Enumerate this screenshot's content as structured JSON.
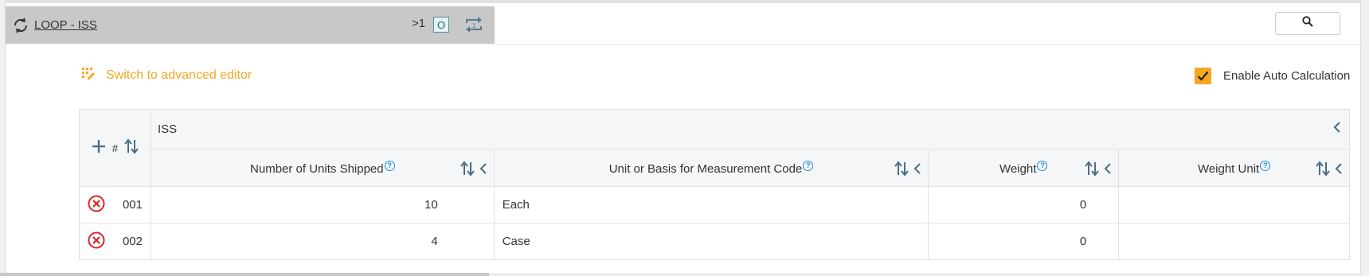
{
  "loop": {
    "title": "LOOP - ISS",
    "repeat_label": ">1",
    "badge": "O"
  },
  "toolbar": {
    "advanced_editor_label": "Switch to advanced editor",
    "auto_calc_label": "Enable Auto Calculation",
    "auto_calc_checked": true
  },
  "grid": {
    "hash_label": "#",
    "group_label": "ISS",
    "columns": [
      {
        "label": "Number of Units Shipped",
        "help": "?"
      },
      {
        "label": "Unit or Basis for Measurement Code",
        "help": "?"
      },
      {
        "label": "Weight",
        "help": "?"
      },
      {
        "label": "Weight Unit",
        "help": "?"
      }
    ],
    "rows": [
      {
        "num": "001",
        "units": "10",
        "basis": "Each",
        "weight": "0",
        "weight_unit": ""
      },
      {
        "num": "002",
        "units": "4",
        "basis": "Case",
        "weight": "0",
        "weight_unit": ""
      }
    ]
  },
  "colors": {
    "accent": "#f5a623",
    "delete": "#d9262c",
    "header_bar": "#c8c8c8",
    "icon_slate": "#5b7a8e"
  },
  "icons": {
    "loop": "refresh-icon",
    "repeat": "repeat-icon",
    "search": "search-icon",
    "advanced_editor": "grid-edit-icon",
    "add": "plus-icon",
    "sort": "sort-icon",
    "collapse": "chevron-left-icon",
    "remove": "remove-circle-icon",
    "help": "help-icon"
  }
}
